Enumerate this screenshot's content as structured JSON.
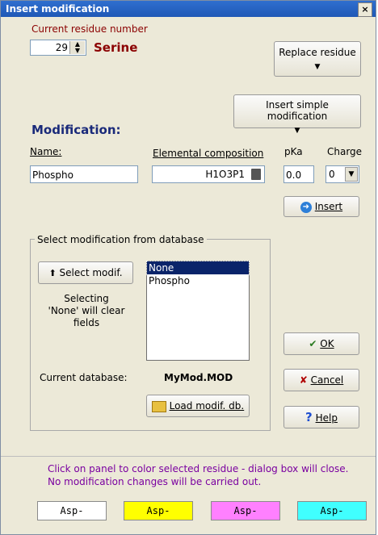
{
  "window": {
    "title": "Insert modification",
    "close_glyph": "×"
  },
  "residue": {
    "label": "Current residue number",
    "number": "29",
    "name": "Serine",
    "replace_label": "Replace residue",
    "insert_simple_label": "Insert simple modification"
  },
  "modification": {
    "heading": "Modification:",
    "name_label": "Name:",
    "name_value": "Phospho",
    "elemental_label": "Elemental composition",
    "elemental_value": "H1O3P1",
    "pka_label": "pKa",
    "pka_value": "0.0",
    "charge_label": "Charge",
    "charge_value": "0",
    "insert_label": "Insert"
  },
  "database": {
    "group_title": "Select modification from database",
    "select_button": "Select modif.",
    "note": "Selecting 'None' will clear fields",
    "items": [
      "None",
      "Phospho"
    ],
    "selected_index": 0,
    "current_label": "Current database:",
    "current_value": "MyMod.MOD",
    "load_button": "Load modif. db."
  },
  "actions": {
    "ok": "OK",
    "cancel": "Cancel",
    "help": "Help"
  },
  "footer": {
    "line1": "Click on panel to color selected residue - dialog box will close.",
    "line2": "No modification changes will be carried out.",
    "swatches": [
      {
        "label": "Asp-",
        "color": "#ffffff"
      },
      {
        "label": "Asp-",
        "color": "#ffff00"
      },
      {
        "label": "Asp-",
        "color": "#ff80ff"
      },
      {
        "label": "Asp-",
        "color": "#40ffff"
      }
    ]
  },
  "colors": {
    "title_bar": "#2f6fcf",
    "residue_red": "#8b0000",
    "heading_navy": "#1a2a7a",
    "info_purple": "#7a00a0"
  }
}
